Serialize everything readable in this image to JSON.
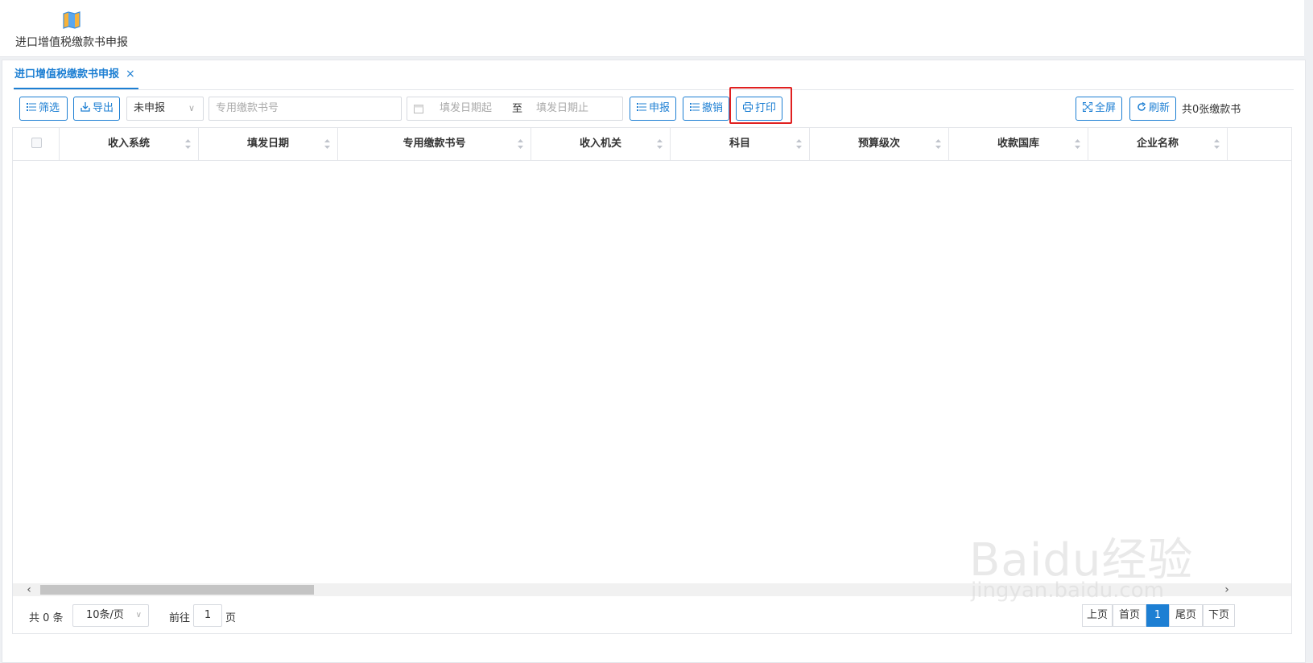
{
  "app_launcher": {
    "label": "进口增值税缴款书申报",
    "icon": "map-icon"
  },
  "tabs": [
    {
      "label": "进口增值税缴款书申报",
      "close": "×"
    }
  ],
  "toolbar": {
    "filter_label": "筛选",
    "export_label": "导出",
    "status_select": {
      "value": "未申报"
    },
    "book_no_placeholder": "专用缴款书号",
    "date_start_placeholder": "填发日期起",
    "date_sep": "至",
    "date_end_placeholder": "填发日期止",
    "declare_label": "申报",
    "revoke_label": "撤销",
    "print_label": "打印",
    "fullscreen_label": "全屏",
    "refresh_label": "刷新",
    "count_text": "共0张缴款书"
  },
  "table": {
    "columns": [
      "收入系统",
      "填发日期",
      "专用缴款书号",
      "收入机关",
      "科目",
      "预算级次",
      "收款国库",
      "企业名称"
    ],
    "rows": []
  },
  "pager": {
    "total_text": "共 0 条",
    "page_size": "10条/页",
    "goto_label": "前往",
    "goto_value": "1",
    "goto_unit": "页",
    "prev": "上页",
    "first": "首页",
    "current": "1",
    "last": "尾页",
    "next": "下页"
  },
  "watermark": {
    "line1": "Baidu经验",
    "line2": "jingyan.baidu.com"
  },
  "colors": {
    "accent": "#1d7fd3",
    "highlight": "#e02020"
  }
}
